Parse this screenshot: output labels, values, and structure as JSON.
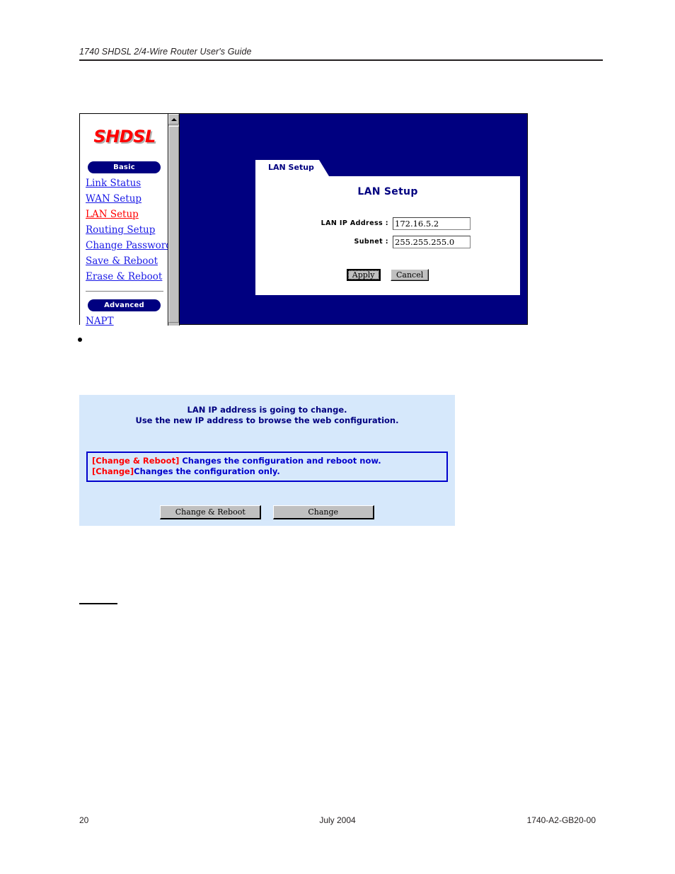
{
  "document": {
    "header_title": "1740 SHDSL 2/4-Wire Router User's Guide",
    "footer": {
      "page_number": "20",
      "date": "July 2004",
      "doc_number": "1740-A2-GB20-00"
    },
    "bullet_text": ""
  },
  "router_ui": {
    "logo_text": "SHDSL",
    "sidebar": {
      "basic_button": "Basic",
      "advanced_button": "Advanced",
      "basic_links": [
        {
          "label": "Link Status",
          "active": false
        },
        {
          "label": "WAN Setup",
          "active": false
        },
        {
          "label": "LAN Setup",
          "active": true
        },
        {
          "label": "Routing Setup",
          "active": false
        },
        {
          "label": "Change Password",
          "active": false
        },
        {
          "label": "Save & Reboot",
          "active": false
        },
        {
          "label": "Erase & Reboot",
          "active": false
        }
      ],
      "advanced_links": [
        {
          "label": "NAPT",
          "active": false
        }
      ],
      "scrollbar": {
        "up_arrow": "scroll-up-arrow"
      }
    },
    "panel": {
      "tab_label": "LAN Setup",
      "title": "LAN Setup",
      "fields": [
        {
          "label": "LAN IP Address :",
          "value": "172.16.5.2"
        },
        {
          "label": "Subnet :",
          "value": "255.255.255.0"
        }
      ],
      "buttons": [
        {
          "label": "Apply",
          "focused": true
        },
        {
          "label": "Cancel",
          "focused": false
        }
      ]
    },
    "colors": {
      "background": "#000080",
      "accent_text": "#000080",
      "logo": "#ff0000",
      "link": "#1a1ae6",
      "link_active": "#ff0000"
    }
  },
  "change_dialog": {
    "message_line1": "LAN IP address is going to change.",
    "message_line2": "Use the new IP address to browse the web configuration.",
    "note": {
      "line1_key": "[Change & Reboot]",
      "line1_desc": " Changes the configuration and reboot now.",
      "line2_key": "[Change]",
      "line2_desc": "Changes the configuration only."
    },
    "buttons": [
      {
        "label": "Change & Reboot"
      },
      {
        "label": "Change"
      }
    ],
    "colors": {
      "background": "#d6e8fb",
      "note_border": "#0000cc",
      "key_color": "#ff0000",
      "desc_color": "#0000cc",
      "heading_color": "#000080"
    }
  }
}
